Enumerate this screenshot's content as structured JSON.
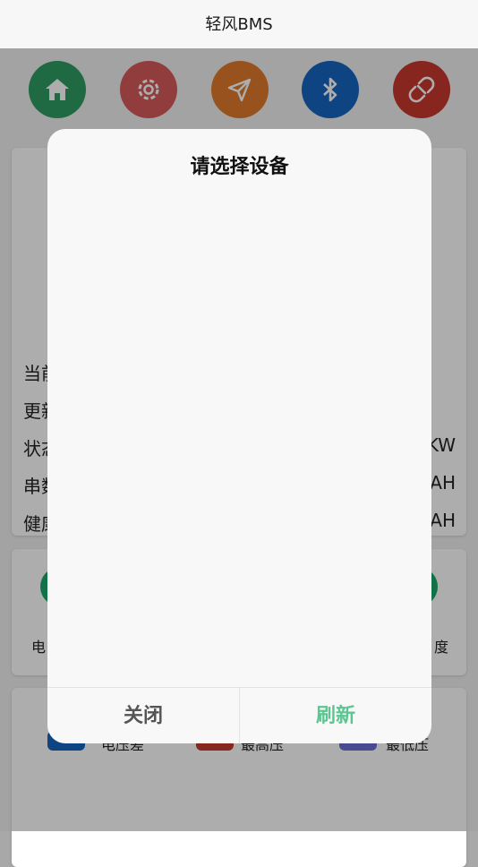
{
  "app": {
    "title": "轻风BMS"
  },
  "toolbar": {
    "buttons": [
      {
        "icon": "home-icon",
        "color": "#2e9d63"
      },
      {
        "icon": "gear-icon",
        "color": "#d85a5a"
      },
      {
        "icon": "send-icon",
        "color": "#e07a2d"
      },
      {
        "icon": "bluetooth-icon",
        "color": "#1565c0"
      },
      {
        "icon": "unlink-icon",
        "color": "#c8382f"
      }
    ]
  },
  "info": {
    "labels": [
      "当前",
      "更新",
      "状态",
      "串数",
      "健康"
    ],
    "units": [
      "KW",
      "AH",
      "AH"
    ]
  },
  "stats": {
    "left_label": "电",
    "right_label": "度"
  },
  "cells": {
    "labels": [
      "电压差",
      "最高压",
      "最低压"
    ]
  },
  "dialog": {
    "title": "请选择设备",
    "devices": [],
    "close_label": "关闭",
    "refresh_label": "刷新",
    "refresh_color": "#5cc591"
  }
}
